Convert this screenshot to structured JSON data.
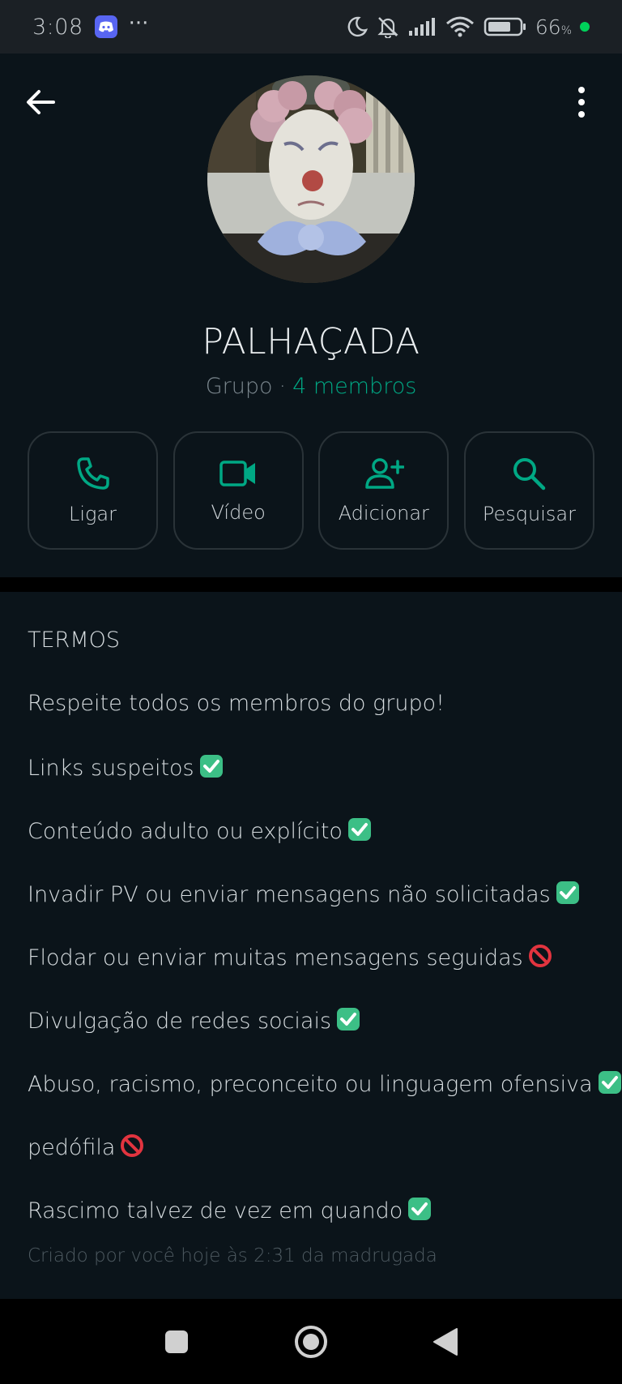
{
  "status_bar": {
    "time": "3:08",
    "more": "···",
    "battery": "66",
    "battery_unit": "%"
  },
  "header": {
    "group_name": "PALHAÇADA",
    "type_label": "Grupo",
    "separator": "·",
    "members": "4 membros"
  },
  "actions": [
    {
      "label": "Ligar",
      "icon": "phone-icon"
    },
    {
      "label": "Vídeo",
      "icon": "video-icon"
    },
    {
      "label": "Adicionar",
      "icon": "add-person-icon"
    },
    {
      "label": "Pesquisar",
      "icon": "search-icon"
    }
  ],
  "description": {
    "lines": [
      {
        "text": "TERMOS",
        "emoji": ""
      },
      {
        "text": "Respeite todos os membros do grupo!",
        "emoji": ""
      },
      {
        "text": "Links suspeitos",
        "emoji": "check-mark-emoji"
      },
      {
        "text": "Conteúdo adulto ou explícito",
        "emoji": "check-mark-emoji"
      },
      {
        "text": "Invadir PV ou enviar mensagens não solicitadas",
        "emoji": "check-mark-emoji"
      },
      {
        "text": "Flodar ou enviar muitas mensagens seguidas",
        "emoji": "prohibited-emoji"
      },
      {
        "text": "Divulgação de redes sociais",
        "emoji": "check-mark-emoji"
      },
      {
        "text": "Abuso, racismo, preconceito ou linguagem ofensiva",
        "emoji": "check-mark-emoji"
      },
      {
        "text": "pedófila",
        "emoji": "prohibited-emoji"
      },
      {
        "text": "Rascimo talvez de vez em quando",
        "emoji": "check-mark-emoji"
      }
    ],
    "created": "Criado por você hoje às 2:31 da madrugada"
  },
  "colors": {
    "accent": "#00a884",
    "background": "#0b141a",
    "muted": "#7b878e"
  }
}
